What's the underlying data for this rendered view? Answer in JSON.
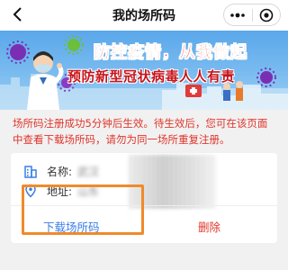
{
  "navbar": {
    "title": "我的场所码",
    "back_icon": "chevron-left-icon",
    "menu_icon": "more-dots-icon",
    "close_icon": "target-circle-icon"
  },
  "banner": {
    "line1": "防控疫情，从我做起",
    "line2": "预防新型冠状病毒人人有责"
  },
  "notice": {
    "text": "场所码注册成功5分钟后生效。待生效后，您可在该页面中查看下载场所码，请勿为同一场所重复注册。"
  },
  "place": {
    "name_label": "名称:",
    "name_value": "武汉",
    "address_label": "地址:",
    "address_value": "山东"
  },
  "actions": {
    "download_label": "下载场所码",
    "delete_label": "删除"
  },
  "colors": {
    "accent_blue": "#3a7ee8",
    "notice_red": "#e0352b",
    "highlight_orange": "#f08a2a"
  }
}
